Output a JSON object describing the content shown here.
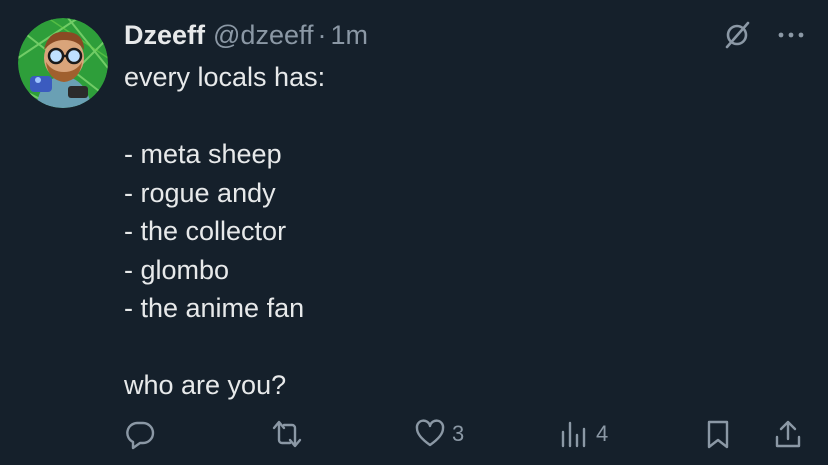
{
  "author": {
    "display_name": "Dzeeff",
    "handle": "@dzeeff",
    "separator": "·",
    "time": "1m",
    "avatar_icon": "avatar-cartoon-man-glasses"
  },
  "post": {
    "lines": [
      "every locals has:",
      "",
      "- meta sheep",
      "- rogue andy",
      "- the collector",
      "- glombo",
      "- the anime fan",
      "",
      "who are you?"
    ]
  },
  "top_icons": {
    "grok": "grok-icon",
    "more": "more-icon"
  },
  "actions": {
    "reply": {
      "icon": "reply-icon",
      "count": ""
    },
    "repost": {
      "icon": "repost-icon",
      "count": ""
    },
    "like": {
      "icon": "heart-icon",
      "count": "3"
    },
    "views": {
      "icon": "views-icon",
      "count": "4"
    },
    "bookmark": {
      "icon": "bookmark-icon"
    },
    "share": {
      "icon": "share-icon"
    }
  },
  "colors": {
    "background": "#15202b",
    "text": "#e7e9ea",
    "secondary": "#8b98a5"
  }
}
